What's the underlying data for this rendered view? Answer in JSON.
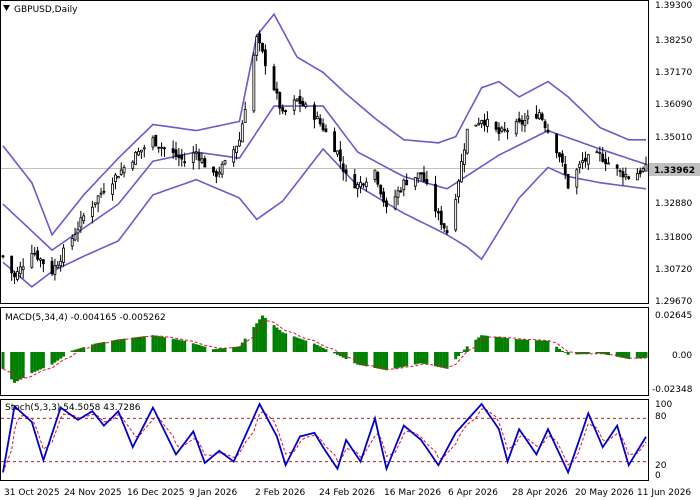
{
  "header": {
    "symbol_label": "GBPUSD,Daily"
  },
  "price_panel": {
    "y_ticks": [
      "1.39300",
      "1.38250",
      "1.37170",
      "1.36090",
      "1.35010",
      "1.33962",
      "1.32880",
      "1.31800",
      "1.30720",
      "1.29670"
    ],
    "current_price": "1.33962",
    "colors": {
      "bollinger": "#6a5acd",
      "candle": "#000000",
      "price_line": "#c0c0c0",
      "price_label_bg": "#c0c0c0"
    }
  },
  "macd_panel": {
    "title": "MACD(5,34,4) -0.004165 -0.005262",
    "y_ticks": [
      "0.02645",
      "0.00",
      "-0.02348"
    ],
    "colors": {
      "histogram": "#008000",
      "signal": "#dc143c"
    }
  },
  "stoch_panel": {
    "title": "Stoch(5,3,3) 54.5058 43.7286",
    "y_ticks": [
      "100",
      "80",
      "20",
      "0"
    ],
    "colors": {
      "main": "#0000cd",
      "signal": "#dc143c",
      "levels": "#b22222"
    }
  },
  "x_axis": {
    "labels": [
      "31 Oct 2025",
      "24 Nov 2025",
      "16 Dec 2025",
      "9 Jan 2026",
      "2 Feb 2026",
      "24 Feb 2026",
      "16 Mar 2026",
      "6 Apr 2026",
      "28 Apr 2026",
      "20 May 2026",
      "11 Jun 2026"
    ]
  },
  "chart_data": {
    "type": "candlestick",
    "symbol": "GBPUSD",
    "timeframe": "Daily",
    "x_range": [
      "31 Oct 2025",
      "11 Jun 2026"
    ],
    "price_ylim": [
      1.2967,
      1.393
    ],
    "close_anchors": [
      {
        "date": "31 Oct 2025",
        "close": 1.311
      },
      {
        "date": "4 Nov 2025",
        "close": 1.304
      },
      {
        "date": "10 Nov 2025",
        "close": 1.313
      },
      {
        "date": "17 Nov 2025",
        "close": 1.306
      },
      {
        "date": "24 Nov 2025",
        "close": 1.317
      },
      {
        "date": "28 Nov 2025",
        "close": 1.324
      },
      {
        "date": "5 Dec 2025",
        "close": 1.333
      },
      {
        "date": "10 Dec 2025",
        "close": 1.338
      },
      {
        "date": "16 Dec 2025",
        "close": 1.344
      },
      {
        "date": "22 Dec 2025",
        "close": 1.349
      },
      {
        "date": "26 Dec 2025",
        "close": 1.346
      },
      {
        "date": "2 Jan 2026",
        "close": 1.342
      },
      {
        "date": "6 Jan 2026",
        "close": 1.345
      },
      {
        "date": "12 Jan 2026",
        "close": 1.337
      },
      {
        "date": "16 Jan 2026",
        "close": 1.341
      },
      {
        "date": "21 Jan 2026",
        "close": 1.349
      },
      {
        "date": "27 Jan 2026",
        "close": 1.382
      },
      {
        "date": "29 Jan 2026",
        "close": 1.377
      },
      {
        "date": "2 Feb 2026",
        "close": 1.366
      },
      {
        "date": "5 Feb 2026",
        "close": 1.357
      },
      {
        "date": "10 Feb 2026",
        "close": 1.362
      },
      {
        "date": "16 Feb 2026",
        "close": 1.357
      },
      {
        "date": "19 Feb 2026",
        "close": 1.353
      },
      {
        "date": "24 Feb 2026",
        "close": 1.345
      },
      {
        "date": "27 Feb 2026",
        "close": 1.337
      },
      {
        "date": "3 Mar 2026",
        "close": 1.334
      },
      {
        "date": "9 Mar 2026",
        "close": 1.339
      },
      {
        "date": "13 Mar 2026",
        "close": 1.326
      },
      {
        "date": "19 Mar 2026",
        "close": 1.335
      },
      {
        "date": "25 Mar 2026",
        "close": 1.338
      },
      {
        "date": "31 Mar 2026",
        "close": 1.324
      },
      {
        "date": "3 Apr 2026",
        "close": 1.319
      },
      {
        "date": "6 Apr 2026",
        "close": 1.331
      },
      {
        "date": "10 Apr 2026",
        "close": 1.352
      },
      {
        "date": "15 Apr 2026",
        "close": 1.356
      },
      {
        "date": "21 Apr 2026",
        "close": 1.351
      },
      {
        "date": "28 Apr 2026",
        "close": 1.354
      },
      {
        "date": "5 May 2026",
        "close": 1.358
      },
      {
        "date": "8 May 2026",
        "close": 1.352
      },
      {
        "date": "12 May 2026",
        "close": 1.344
      },
      {
        "date": "15 May 2026",
        "close": 1.334
      },
      {
        "date": "20 May 2026",
        "close": 1.342
      },
      {
        "date": "26 May 2026",
        "close": 1.344
      },
      {
        "date": "1 Jun 2026",
        "close": 1.339
      },
      {
        "date": "5 Jun 2026",
        "close": 1.337
      },
      {
        "date": "11 Jun 2026",
        "close": 1.3396
      }
    ],
    "bollinger": {
      "upper_anchors": [
        {
          "date": "31 Oct 2025",
          "value": 1.347
        },
        {
          "date": "10 Nov 2025",
          "value": 1.335
        },
        {
          "date": "17 Nov 2025",
          "value": 1.318
        },
        {
          "date": "28 Nov 2025",
          "value": 1.331
        },
        {
          "date": "10 Dec 2025",
          "value": 1.343
        },
        {
          "date": "22 Dec 2025",
          "value": 1.354
        },
        {
          "date": "6 Jan 2026",
          "value": 1.352
        },
        {
          "date": "21 Jan 2026",
          "value": 1.355
        },
        {
          "date": "27 Jan 2026",
          "value": 1.383
        },
        {
          "date": "2 Feb 2026",
          "value": 1.39
        },
        {
          "date": "10 Feb 2026",
          "value": 1.376
        },
        {
          "date": "19 Feb 2026",
          "value": 1.371
        },
        {
          "date": "27 Feb 2026",
          "value": 1.364
        },
        {
          "date": "9 Mar 2026",
          "value": 1.356
        },
        {
          "date": "19 Mar 2026",
          "value": 1.349
        },
        {
          "date": "31 Mar 2026",
          "value": 1.348
        },
        {
          "date": "6 Apr 2026",
          "value": 1.35
        },
        {
          "date": "15 Apr 2026",
          "value": 1.366
        },
        {
          "date": "21 Apr 2026",
          "value": 1.368
        },
        {
          "date": "28 Apr 2026",
          "value": 1.363
        },
        {
          "date": "8 May 2026",
          "value": 1.368
        },
        {
          "date": "15 May 2026",
          "value": 1.363
        },
        {
          "date": "26 May 2026",
          "value": 1.353
        },
        {
          "date": "5 Jun 2026",
          "value": 1.349
        },
        {
          "date": "11 Jun 2026",
          "value": 1.349
        }
      ],
      "middle_anchors": [
        {
          "date": "31 Oct 2025",
          "value": 1.328
        },
        {
          "date": "17 Nov 2025",
          "value": 1.313
        },
        {
          "date": "10 Dec 2025",
          "value": 1.328
        },
        {
          "date": "22 Dec 2025",
          "value": 1.342
        },
        {
          "date": "6 Jan 2026",
          "value": 1.345
        },
        {
          "date": "21 Jan 2026",
          "value": 1.343
        },
        {
          "date": "2 Feb 2026",
          "value": 1.36
        },
        {
          "date": "19 Feb 2026",
          "value": 1.36
        },
        {
          "date": "3 Mar 2026",
          "value": 1.345
        },
        {
          "date": "19 Mar 2026",
          "value": 1.337
        },
        {
          "date": "3 Apr 2026",
          "value": 1.333
        },
        {
          "date": "21 Apr 2026",
          "value": 1.344
        },
        {
          "date": "8 May 2026",
          "value": 1.352
        },
        {
          "date": "26 May 2026",
          "value": 1.346
        },
        {
          "date": "11 Jun 2026",
          "value": 1.341
        }
      ],
      "lower_anchors": [
        {
          "date": "31 Oct 2025",
          "value": 1.309
        },
        {
          "date": "10 Nov 2025",
          "value": 1.301
        },
        {
          "date": "17 Nov 2025",
          "value": 1.306
        },
        {
          "date": "28 Nov 2025",
          "value": 1.311
        },
        {
          "date": "10 Dec 2025",
          "value": 1.316
        },
        {
          "date": "22 Dec 2025",
          "value": 1.331
        },
        {
          "date": "6 Jan 2026",
          "value": 1.336
        },
        {
          "date": "21 Jan 2026",
          "value": 1.33
        },
        {
          "date": "27 Jan 2026",
          "value": 1.323
        },
        {
          "date": "5 Feb 2026",
          "value": 1.329
        },
        {
          "date": "19 Feb 2026",
          "value": 1.346
        },
        {
          "date": "3 Mar 2026",
          "value": 1.334
        },
        {
          "date": "19 Mar 2026",
          "value": 1.325
        },
        {
          "date": "3 Apr 2026",
          "value": 1.318
        },
        {
          "date": "10 Apr 2026",
          "value": 1.314
        },
        {
          "date": "15 Apr 2026",
          "value": 1.31
        },
        {
          "date": "28 Apr 2026",
          "value": 1.33
        },
        {
          "date": "8 May 2026",
          "value": 1.34
        },
        {
          "date": "15 May 2026",
          "value": 1.337
        },
        {
          "date": "26 May 2026",
          "value": 1.335
        },
        {
          "date": "11 Jun 2026",
          "value": 1.333
        }
      ]
    },
    "macd": {
      "ylim": [
        -0.0285,
        0.0285
      ],
      "hist_anchors": [
        {
          "date": "31 Oct 2025",
          "value": -0.012
        },
        {
          "date": "4 Nov 2025",
          "value": -0.022
        },
        {
          "date": "10 Nov 2025",
          "value": -0.015
        },
        {
          "date": "17 Nov 2025",
          "value": -0.009
        },
        {
          "date": "24 Nov 2025",
          "value": 0.001
        },
        {
          "date": "2 Dec 2025",
          "value": 0.006
        },
        {
          "date": "10 Dec 2025",
          "value": 0.009
        },
        {
          "date": "22 Dec 2025",
          "value": 0.012
        },
        {
          "date": "2 Jan 2026",
          "value": 0.008
        },
        {
          "date": "12 Jan 2026",
          "value": 0.002
        },
        {
          "date": "21 Jan 2026",
          "value": 0.004
        },
        {
          "date": "29 Jan 2026",
          "value": 0.026
        },
        {
          "date": "5 Feb 2026",
          "value": 0.014
        },
        {
          "date": "16 Feb 2026",
          "value": 0.006
        },
        {
          "date": "24 Feb 2026",
          "value": -0.002
        },
        {
          "date": "3 Mar 2026",
          "value": -0.009
        },
        {
          "date": "13 Mar 2026",
          "value": -0.013
        },
        {
          "date": "25 Mar 2026",
          "value": -0.008
        },
        {
          "date": "3 Apr 2026",
          "value": -0.012
        },
        {
          "date": "10 Apr 2026",
          "value": 0.004
        },
        {
          "date": "15 Apr 2026",
          "value": 0.012
        },
        {
          "date": "28 Apr 2026",
          "value": 0.009
        },
        {
          "date": "8 May 2026",
          "value": 0.008
        },
        {
          "date": "15 May 2026",
          "value": -0.002
        },
        {
          "date": "26 May 2026",
          "value": -0.001
        },
        {
          "date": "5 Jun 2026",
          "value": -0.005
        },
        {
          "date": "11 Jun 2026",
          "value": -0.004165
        }
      ],
      "signal_last": -0.005262
    },
    "stochastic": {
      "ylim": [
        0,
        100
      ],
      "levels": [
        20,
        80
      ],
      "main_anchors": [
        {
          "date": "31 Oct 2025",
          "value": 5
        },
        {
          "date": "4 Nov 2025",
          "value": 97
        },
        {
          "date": "10 Nov 2025",
          "value": 75
        },
        {
          "date": "14 Nov 2025",
          "value": 22
        },
        {
          "date": "20 Nov 2025",
          "value": 95
        },
        {
          "date": "26 Nov 2025",
          "value": 78
        },
        {
          "date": "1 Dec 2025",
          "value": 90
        },
        {
          "date": "5 Dec 2025",
          "value": 70
        },
        {
          "date": "10 Dec 2025",
          "value": 90
        },
        {
          "date": "15 Dec 2025",
          "value": 40
        },
        {
          "date": "22 Dec 2025",
          "value": 95
        },
        {
          "date": "30 Dec 2025",
          "value": 30
        },
        {
          "date": "5 Jan 2026",
          "value": 62
        },
        {
          "date": "9 Jan 2026",
          "value": 18
        },
        {
          "date": "14 Jan 2026",
          "value": 35
        },
        {
          "date": "19 Jan 2026",
          "value": 20
        },
        {
          "date": "28 Jan 2026",
          "value": 100
        },
        {
          "date": "3 Feb 2026",
          "value": 55
        },
        {
          "date": "6 Feb 2026",
          "value": 15
        },
        {
          "date": "11 Feb 2026",
          "value": 55
        },
        {
          "date": "16 Feb 2026",
          "value": 60
        },
        {
          "date": "19 Feb 2026",
          "value": 40
        },
        {
          "date": "24 Feb 2026",
          "value": 10
        },
        {
          "date": "27 Feb 2026",
          "value": 50
        },
        {
          "date": "4 Mar 2026",
          "value": 20
        },
        {
          "date": "9 Mar 2026",
          "value": 80
        },
        {
          "date": "13 Mar 2026",
          "value": 10
        },
        {
          "date": "19 Mar 2026",
          "value": 70
        },
        {
          "date": "25 Mar 2026",
          "value": 50
        },
        {
          "date": "31 Mar 2026",
          "value": 15
        },
        {
          "date": "6 Apr 2026",
          "value": 60
        },
        {
          "date": "15 Apr 2026",
          "value": 100
        },
        {
          "date": "21 Apr 2026",
          "value": 65
        },
        {
          "date": "24 Apr 2026",
          "value": 20
        },
        {
          "date": "28 Apr 2026",
          "value": 65
        },
        {
          "date": "4 May 2026",
          "value": 30
        },
        {
          "date": "8 May 2026",
          "value": 65
        },
        {
          "date": "15 May 2026",
          "value": 5
        },
        {
          "date": "22 May 2026",
          "value": 87
        },
        {
          "date": "27 May 2026",
          "value": 40
        },
        {
          "date": "1 Jun 2026",
          "value": 70
        },
        {
          "date": "5 Jun 2026",
          "value": 15
        },
        {
          "date": "11 Jun 2026",
          "value": 54.5058
        }
      ],
      "signal_last": 43.7286
    }
  }
}
